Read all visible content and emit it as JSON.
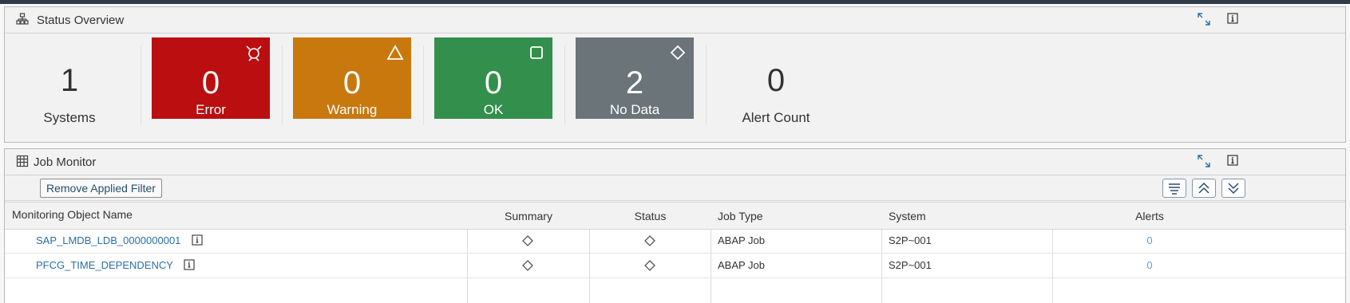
{
  "status_overview": {
    "title": "Status Overview",
    "systems": {
      "value": "1",
      "label": "Systems"
    },
    "error": {
      "value": "0",
      "label": "Error",
      "color": "#bb0e10"
    },
    "warning": {
      "value": "0",
      "label": "Warning",
      "color": "#c8780d"
    },
    "ok": {
      "value": "0",
      "label": "OK",
      "color": "#338f4c"
    },
    "no_data": {
      "value": "2",
      "label": "No Data",
      "color": "#6a7479"
    },
    "alert_count": {
      "value": "0",
      "label": "Alert Count"
    }
  },
  "job_monitor": {
    "title": "Job Monitor",
    "remove_filter_label": "Remove Applied Filter",
    "columns": [
      "Monitoring Object Name",
      "Summary",
      "Status",
      "Job Type",
      "System",
      "Alerts"
    ],
    "rows": [
      {
        "name": "SAP_LMDB_LDB_0000000001",
        "summary_icon": "diamond-icon",
        "status_icon": "diamond-icon",
        "job_type": "ABAP Job",
        "system": "S2P~001",
        "alerts": "0"
      },
      {
        "name": "PFCG_TIME_DEPENDENCY",
        "summary_icon": "diamond-icon",
        "status_icon": "diamond-icon",
        "job_type": "ABAP Job",
        "system": "S2P~001",
        "alerts": "0"
      }
    ]
  }
}
